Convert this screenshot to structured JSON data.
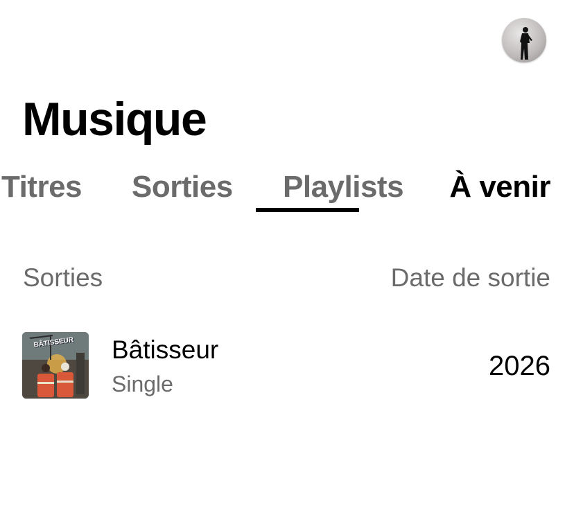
{
  "header": {
    "avatar_icon": "profile-avatar-icon"
  },
  "page": {
    "title": "Musique"
  },
  "tabs": [
    {
      "label": "Titres",
      "selected": false
    },
    {
      "label": "Sorties",
      "selected": false
    },
    {
      "label": "Playlists",
      "selected": true
    },
    {
      "label": "À venir",
      "selected": false
    }
  ],
  "columns": {
    "left": "Sorties",
    "right": "Date de sortie"
  },
  "releases": [
    {
      "cover_text": "BÂTISSEUR",
      "title": "Bâtisseur",
      "type": "Single",
      "year": "2026"
    }
  ],
  "colors": {
    "text_primary": "#000000",
    "text_secondary": "#6b6b6b",
    "background": "#ffffff"
  }
}
